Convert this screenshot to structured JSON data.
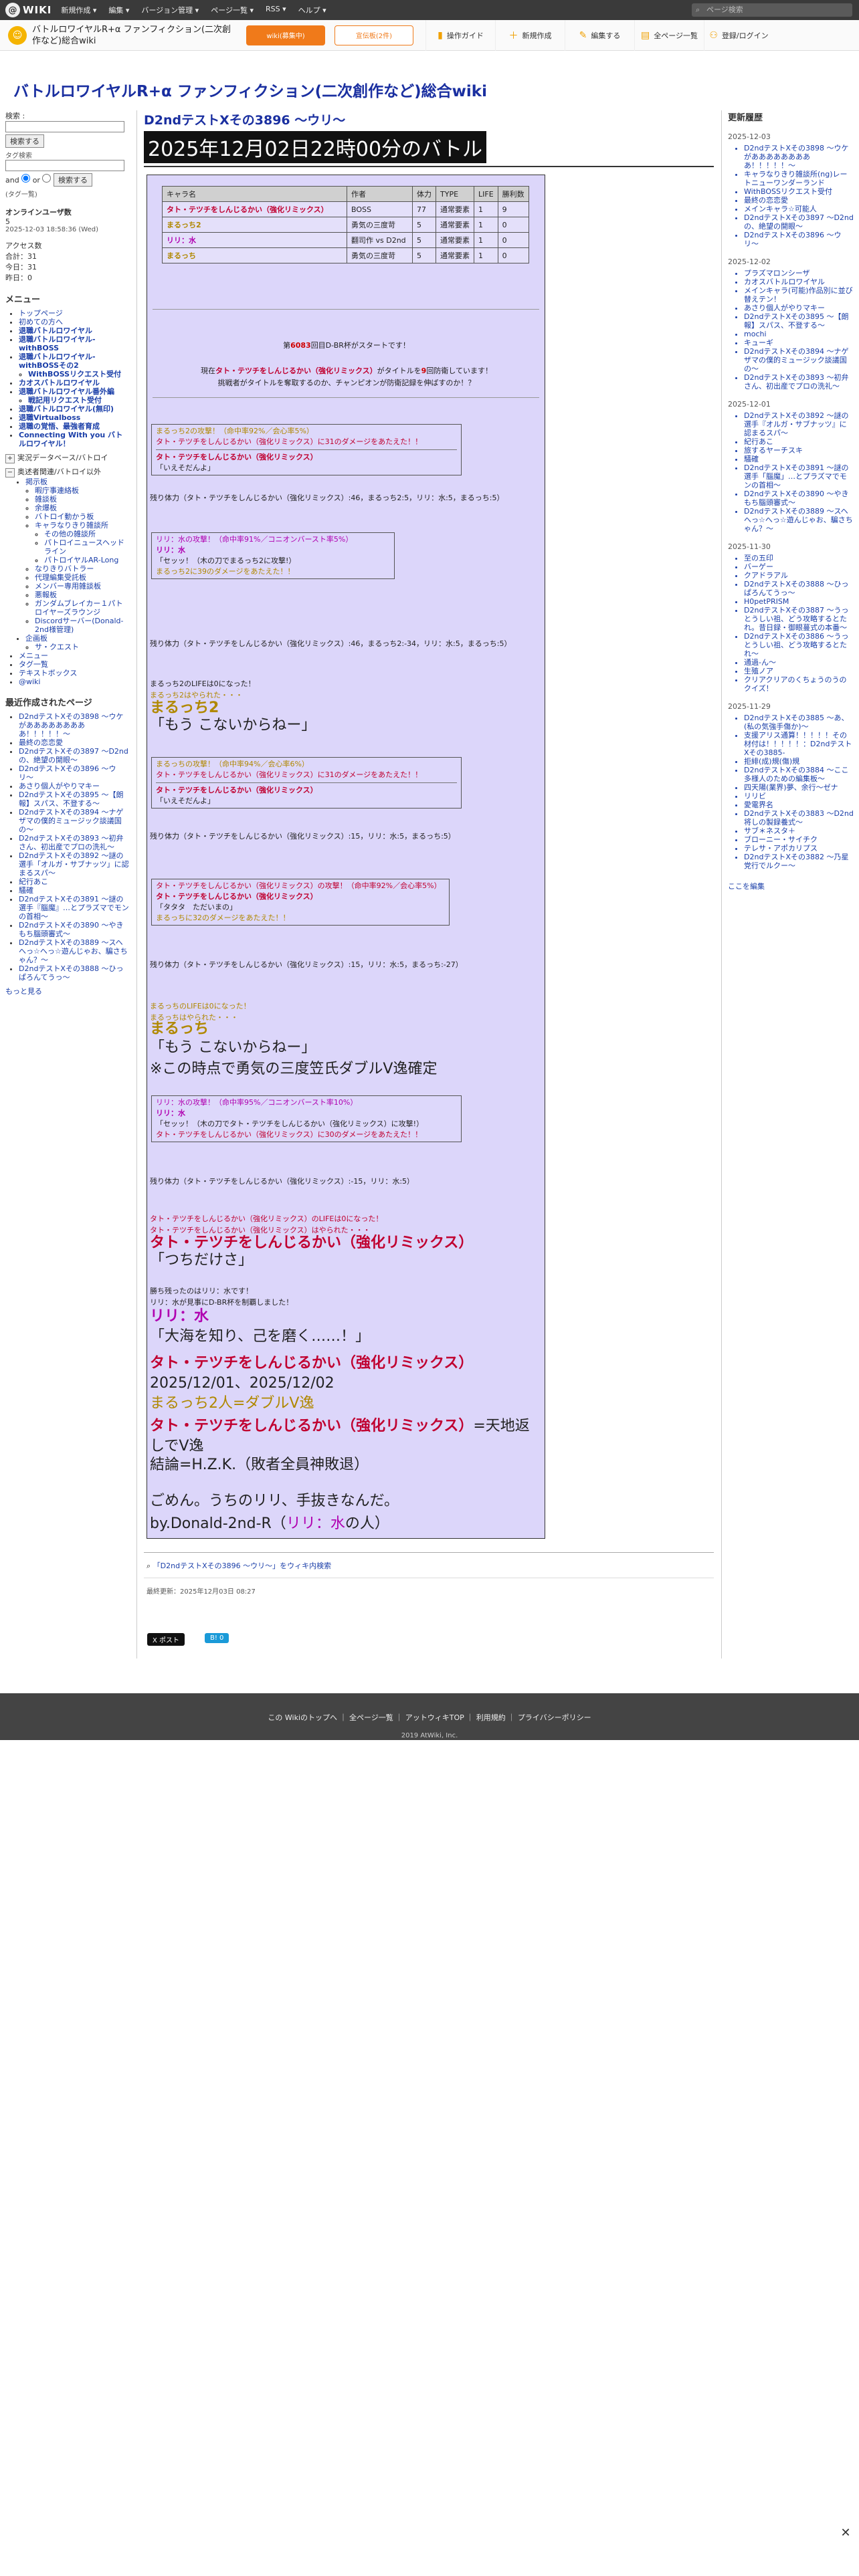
{
  "topbar": {
    "logo": "WIKI",
    "menu": [
      "新規作成 ▾",
      "編集 ▾",
      "バージョン管理 ▾",
      "ページ一覧 ▾",
      "RSS ▾",
      "ヘルプ ▾"
    ],
    "search_placeholder": "ページ検索"
  },
  "wiki": {
    "name": "バトルロワイヤルR+α ファンフィクション(二次創作など)総合wiki",
    "wiki_btn": "wiki(募集中)",
    "ad_btn": "宣伝板(2件)",
    "actions": [
      "操作ガイド",
      "新規作成",
      "編集する",
      "全ページ一覧",
      "登録/ログイン"
    ]
  },
  "site_title": "バトルロワイヤルR+α ファンフィクション(二次創作など)総合wiki",
  "left": {
    "search_label": "検索 :",
    "search_btn": "検索する",
    "tag_label": "タグ検索",
    "and": "and",
    "or": "or",
    "tag_btn": "検索する",
    "tag_help": "(タグ一覧)",
    "online_label": "オンラインユーザ数",
    "online_count": "5",
    "timestamp": "2025-12-03 18:58:36 (Wed)",
    "access_label": "アクセス数",
    "total": "合計：31",
    "today": "今日：31",
    "yesterday": "昨日：0",
    "menu_heading": "メニュー",
    "menu": [
      "トップページ",
      "初めての方へ",
      "退職バトルロワイヤル",
      "退職バトルロワイヤル-withBOSS",
      "退職バトルロワイヤル-withBOSSその2",
      "WithBOSSリクエスト受付",
      "カオスバトルロワイヤル",
      "退職バトルロワイヤル番外編",
      "戦記用リクエスト受付",
      "退職バトルロワイヤル(無印)",
      "退職Virtualboss",
      "退職の覚悟、最強者育成",
      "Connecting With you バトルロワイヤル！"
    ],
    "tree1": "実況データベース/バトロイ",
    "tree2": "奥述者関連/バトロイ以外",
    "sub": [
      "掲示板",
      "暇庁事連絡板",
      "雑談板",
      "余爆板",
      "バトロイ動かう板",
      "キャラなりきり雑談所",
      "その他の雑談所",
      "パトロイニュースヘッドライン",
      "パトロイヤルAR-Long",
      "なりきりバトラー",
      "代理編集受託板",
      "メンバー専用雑談板",
      "悪報板",
      "ガンダムブレイカー１パトロイヤーズラウンジ",
      "Discordサーバー(Donald-2nd様管理)"
    ],
    "sub2": [
      "企画板",
      "サ・クエスト"
    ],
    "misc": [
      "メニュー",
      "タグ一覧",
      "テキストボックス",
      "@wiki"
    ],
    "recent_heading": "最近作成されたページ",
    "recent": [
      "D2ndテストXその3898 〜ウケがあああああああああ！！！！！〜",
      "最終の恋恋愛",
      "D2ndテストXその3897 〜D2ndの、絶望の開眼〜",
      "D2ndテストXその3896 〜ウリ〜",
      "あさり個人がやりマキー",
      "D2ndテストXその3895 〜【朗報】スパス、不登する〜",
      "D2ndテストXその3894 〜ナゲザマの僕的ミュージック談議国の〜",
      "D2ndテストXその3893 〜初弁さん、初出産でプロの洗礼〜",
      "D2ndテストXその3892 〜謎の選手「オルガ・サブナッツ」に認まるスパ〜",
      "紀行あこ",
      "騒確",
      "D2ndテストXその3891 〜謎の選手『腦魔』…とプラズマでモンの首相〜",
      "D2ndテストXその3890 〜やきもち腦頭審式〜",
      "D2ndテストXその3889 〜スヘへっ☆へっ☆遊んじゃお、騙さちゃん？〜",
      "D2ndテストXその3888 〜ひっぱろんてうっ〜"
    ],
    "more": "もっと見る"
  },
  "page": {
    "subtitle": "D2ndテストXその3896 〜ウリ〜",
    "title": "2025年12月02日22時00分のバトル"
  },
  "table": {
    "headers": [
      "キャラ名",
      "作者",
      "体力",
      "TYPE",
      "LIFE",
      "勝利数"
    ],
    "rows": [
      [
        "タト・テツチをしんじるかい（強化リミックス）",
        "BOSS",
        "77",
        "通常要素",
        "1",
        "9"
      ],
      [
        "まるっち2",
        "勇気の三度苛",
        "5",
        "通常要素",
        "1",
        "0"
      ],
      [
        "リリ：水",
        "翻司作 vs D2nd",
        "5",
        "通常要素",
        "1",
        "0"
      ],
      [
        "まるっち",
        "勇気の三度苛",
        "5",
        "通常要素",
        "1",
        "0"
      ]
    ]
  },
  "intro": {
    "line1a": "第",
    "line1b": "6083",
    "line1c": "回目D-BR杯がスタートです！",
    "line2a": "現在",
    "line2b": "タト・テツチをしんじるかい（強化リミックス）",
    "line2c": "がタイトルを",
    "line2d": "9",
    "line2e": "回防衛しています！",
    "line3": "挑戦者がタイトルを奪取するのか、チャンピオンが防衛記録を伸ばすのか！？"
  },
  "log": {
    "a1_head": "まるっち2の攻撃！（命中率92%／会心率5%）",
    "a1_body": "タト・テツチをしんじるかい（強化リミックス）に31のダメージをあたえた！！",
    "a1_b_name": "タト・テツチをしんじるかい（強化リミックス）",
    "a1_b_text": "「いえそだんよ」",
    "hp1": "残り体力（タト・テツチをしんじるかい（強化リミックス）:46，まるっち2:5，リリ：水:5，まるっち:5）",
    "a2_head": "リリ：水の攻撃！（命中率91%／コニオンバースト率5%）",
    "a2_name": "リリ：水",
    "a2_text": "「セッッ！（木の刀でまるっち2に攻撃!）",
    "a2_dmg": "まるっち2に39のダメージをあたえた！！",
    "hp2": "残り体力（タト・テツチをしんじるかい（強化リミックス）:46，まるっち2:-34，リリ：水:5，まるっち:5）",
    "dead1a": "まるっち2のLIFEは0になった！",
    "dead1b": "まるっち2はやられた・・・",
    "dead1_name": "まるっち2",
    "dead1_quote": "「もう こないからねー」",
    "a3_head": "まるっちの攻撃！（命中率94%／会心率6%）",
    "a3_body": "タト・テツチをしんじるかい（強化リミックス）に31のダメージをあたえた！！",
    "a3_b_name": "タト・テツチをしんじるかい（強化リミックス）",
    "a3_b_text": "「いえそだんよ」",
    "hp3": "残り体力（タト・テツチをしんじるかい（強化リミックス）:15，リリ：水:5，まるっち:5）",
    "a4_head": "タト・テツチをしんじるかい（強化リミックス）の攻撃！（命中率92%／会心率5%）",
    "a4_name": "タト・テツチをしんじるかい（強化リミックス）",
    "a4_text": "「タタタ　ただいまの」",
    "a4_dmg": "まるっちに32のダメージをあたえた！！",
    "hp4": "残り体力（タト・テツチをしんじるかい（強化リミックス）:15，リリ：水:5，まるっち:-27）",
    "dead2a": "まるっちのLIFEは0になった！",
    "dead2b": "まるっちはやられた・・・",
    "dead2_name": "まるっち",
    "dead2_quote": "「もう こないからねー」",
    "note": "※この時点で勇気の三度笠氏ダブルV逸確定",
    "a5_head": "リリ：水の攻撃！（命中率95%／コニオンバースト率10%）",
    "a5_name": "リリ：水",
    "a5_text": "「セッッ！（木の刀でタト・テツチをしんじるかい（強化リミックス）に攻撃!）",
    "a5_dmg": "タト・テツチをしんじるかい（強化リミックス）に30のダメージをあたえた！！",
    "hp5": "残り体力（タト・テツチをしんじるかい（強化リミックス）:-15，リリ：水:5）",
    "dead3a": "タト・テツチをしんじるかい（強化リミックス）のLIFEは0になった！",
    "dead3b": "タト・テツチをしんじるかい（強化リミックス）はやられた・・・",
    "dead3_name": "タト・テツチをしんじるかい（強化リミックス）",
    "dead3_quote": "「つちだけさ」",
    "win1": "勝ち残ったのはリリ：水です！",
    "win2": "リリ：水が見事にD-BR杯を制覇しました！",
    "win_name": "リリ：水",
    "win_quote": "「大海を知り、己を磨く……！」",
    "end1": "タト・テツチをしんじるかい（強化リミックス）",
    "end2": "2025/12/01、2025/12/02",
    "end3": "まるっち2人=ダブルV逸",
    "end4a": "タト・テツチをしんじるかい（強化リミックス）",
    "end4b": "=天地返しでV逸",
    "end5": "結論=H.Z.K.（敗者全員神敗退）",
    "end6": "ごめん。うちのリリ、手抜きなんだ。",
    "end7a": "by.Donald-2nd-R（",
    "end7b": "リリ：水",
    "end7c": "の人）"
  },
  "tag_search": "「D2ndテストXその3896 〜ウリ〜」をウィキ内検索",
  "last_updated": "最終更新：2025年12月03日 08:27",
  "share": {
    "x": "X ポスト",
    "note": "B! 0"
  },
  "right": {
    "heading": "更新履歴",
    "groups": [
      {
        "date": "2025-12-03",
        "items": [
          "D2ndテストXその3898 〜ウケがあああああああああ！！！！！〜",
          "キャラなりきり雑談所(ng)レートニューワンダーランド",
          "WithBOSSリクエスト受付",
          "最終の恋恋愛",
          "メインキャラ☆可能人",
          "D2ndテストXその3897 〜D2ndの、絶望の開眼〜",
          "D2ndテストXその3896 〜ウリ〜"
        ]
      },
      {
        "date": "2025-12-02",
        "items": [
          "プラズマロンシーザ",
          "カオスバトルロワイヤル",
          "メインキャラ(可能)作品別に並び替えテン！",
          "あさり個人がやりマキー",
          "D2ndテストXその3895 〜【朗報】スパス、不登する〜",
          "mochi",
          "キューギ",
          "D2ndテストXその3894 〜ナゲザマの僕的ミュージック談議国の〜",
          "D2ndテストXその3893 〜初弁さん、初出産でプロの洗礼〜"
        ]
      },
      {
        "date": "2025-12-01",
        "items": [
          "D2ndテストXその3892 〜謎の選手『オルガ・サブナッツ』に認まるスパ〜",
          "紀行あこ",
          "旅するヤーチスキ",
          "騒確",
          "D2ndテストXその3891 〜謎の選手「腦魔」…とプラズマでモンの首相〜",
          "D2ndテストXその3890 〜やきもち腦頭審式〜",
          "D2ndテストXその3889 〜スヘへっ☆へっ☆遊んじゃお、騙さちゃん？〜"
        ]
      },
      {
        "date": "2025-11-30",
        "items": [
          "至の五印",
          "バーゲー",
          "クアドラアル",
          "D2ndテストXその3888 〜ひっぱろんてうっ〜",
          "H0petPRISM",
          "D2ndテストXその3887 〜うっとうしい祖、どう攻略するとたれ。昔日録・御眼蔓式の本番〜",
          "D2ndテストXその3886 〜うっとうしい祖、どう攻略するとたれ〜",
          "通過-ん〜",
          "生殖ノア",
          "クリアクリアのくちょうのうのクイズ！"
        ]
      },
      {
        "date": "2025-11-29",
        "items": [
          "D2ndテストXその3885 〜あ、(私の気強手傷か)〜",
          "支援アリス通算！！！！！その材付は！！！！！：D2ndテストXその3885-",
          "拒緋(成)規(傷)規",
          "D2ndテストXその3884 〜ここ多様人のための編集板〜",
          "四天陽(業界)夢、余行〜ゼナ",
          "リリビ",
          "愛電界名",
          "D2ndテストXその3883 〜D2nd将しの製録養式〜",
          "サブ＊ネスタ＋",
          "ブローニー・サイチク",
          "テレサ・アポカリプス",
          "D2ndテストXその3882 〜乃星党行でルクー〜"
        ]
      }
    ],
    "edit_link": "ここを編集"
  },
  "footer": {
    "links": [
      "この Wikiのトップへ",
      "全ページ一覧",
      "アットウィキTOP",
      "利用規約",
      "プライバシーポリシー"
    ],
    "copy": "2019 AtWiki, Inc."
  },
  "close": "✕"
}
